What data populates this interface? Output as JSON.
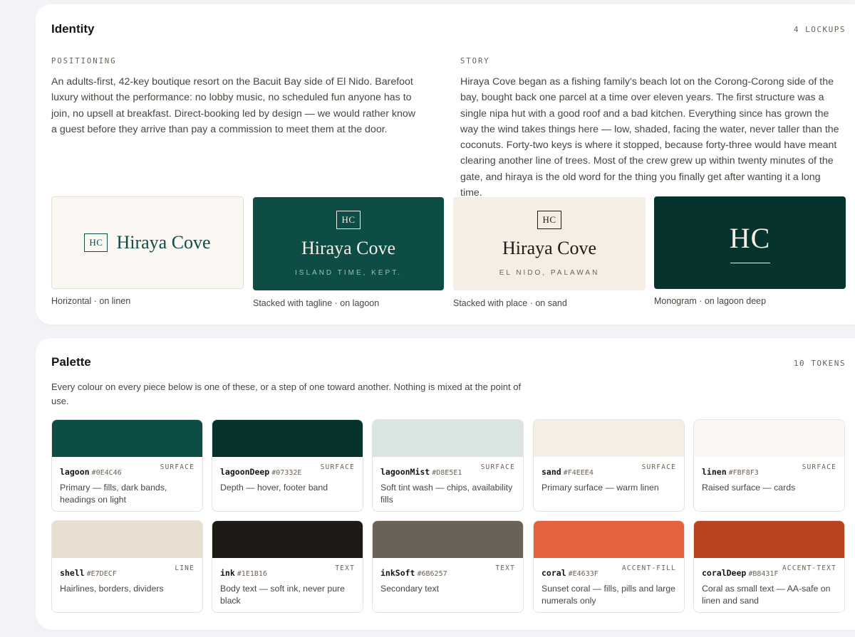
{
  "identity": {
    "title": "Identity",
    "count": "4 LOCKUPS",
    "positioning_label": "POSITIONING",
    "positioning_text": "An adults-first, 42-key boutique resort on the Bacuit Bay side of El Nido. Barefoot luxury without the performance: no lobby music, no scheduled fun anyone has to join, no upsell at breakfast. Direct-booking led by design — we would rather know a guest before they arrive than pay a commission to meet them at the door.",
    "story_label": "STORY",
    "story_text": "Hiraya Cove began as a fishing family's beach lot on the Corong-Corong side of the bay, bought back one parcel at a time over eleven years. The first structure was a single nipa hut with a good roof and a bad kitchen. Everything since has grown the way the wind takes things here — low, shaded, facing the water, never taller than the coconuts. Forty-two keys is where it stopped, because forty-three would have meant clearing another line of trees. Most of the crew grew up within twenty minutes of the gate, and hiraya is the old word for the thing you finally get after wanting it a long time.",
    "lockups": [
      {
        "monogram": "HC",
        "wordmark": "Hiraya Cove",
        "caption": "Horizontal · on linen"
      },
      {
        "monogram": "HC",
        "wordmark": "Hiraya Cove",
        "tagline": "ISLAND TIME, KEPT.",
        "caption": "Stacked with tagline · on lagoon"
      },
      {
        "monogram": "HC",
        "wordmark": "Hiraya Cove",
        "tagline": "EL NIDO, PALAWAN",
        "caption": "Stacked with place · on sand"
      },
      {
        "monogram": "HC",
        "caption": "Monogram · on lagoon deep"
      }
    ]
  },
  "palette": {
    "title": "Palette",
    "count": "10 TOKENS",
    "intro": "Every colour on every piece below is one of these, or a step of one toward another. Nothing is mixed at the point of use.",
    "tokens": [
      {
        "name": "lagoon",
        "hex": "#0E4C46",
        "role": "SURFACE",
        "desc": "Primary — fills, dark bands, headings on light"
      },
      {
        "name": "lagoonDeep",
        "hex": "#07332E",
        "role": "SURFACE",
        "desc": "Depth — hover, footer band"
      },
      {
        "name": "lagoonMist",
        "hex": "#D8E5E1",
        "role": "SURFACE",
        "desc": "Soft tint wash — chips, availability fills"
      },
      {
        "name": "sand",
        "hex": "#F4EEE4",
        "role": "SURFACE",
        "desc": "Primary surface — warm linen"
      },
      {
        "name": "linen",
        "hex": "#FBF8F3",
        "role": "SURFACE",
        "desc": "Raised surface — cards"
      },
      {
        "name": "shell",
        "hex": "#E7DECF",
        "role": "LINE",
        "desc": "Hairlines, borders, dividers"
      },
      {
        "name": "ink",
        "hex": "#1E1B16",
        "role": "TEXT",
        "desc": "Body text — soft ink, never pure black"
      },
      {
        "name": "inkSoft",
        "hex": "#6B6257",
        "role": "TEXT",
        "desc": "Secondary text"
      },
      {
        "name": "coral",
        "hex": "#E4633F",
        "role": "ACCENT-FILL",
        "desc": "Sunset coral — fills, pills and large numerals only"
      },
      {
        "name": "coralDeep",
        "hex": "#B8431F",
        "role": "ACCENT-TEXT",
        "desc": "Coral as small text — AA-safe on linen and sand"
      }
    ]
  }
}
